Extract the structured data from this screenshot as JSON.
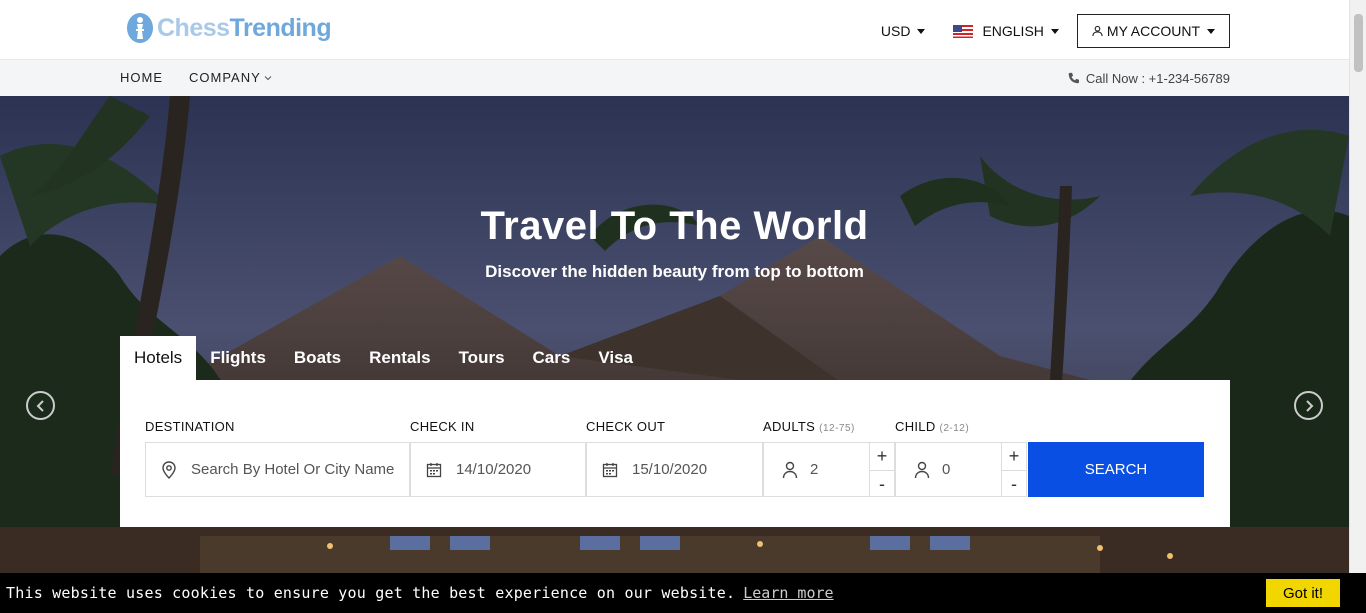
{
  "header": {
    "logo_text_a": "Chess",
    "logo_text_b": "Trending",
    "currency": "USD",
    "language": "ENGLISH",
    "account_label": "MY ACCOUNT"
  },
  "nav": {
    "items": [
      {
        "label": "HOME"
      },
      {
        "label": "COMPANY"
      }
    ],
    "call_text": "Call Now : +1-234-56789"
  },
  "hero": {
    "title": "Travel To The World",
    "subtitle": "Discover the hidden beauty from top to bottom"
  },
  "search": {
    "tabs": [
      {
        "label": "Hotels",
        "active": true
      },
      {
        "label": "Flights"
      },
      {
        "label": "Boats"
      },
      {
        "label": "Rentals"
      },
      {
        "label": "Tours"
      },
      {
        "label": "Cars"
      },
      {
        "label": "Visa"
      }
    ],
    "labels": {
      "destination": "DESTINATION",
      "check_in": "CHECK IN",
      "check_out": "CHECK OUT",
      "adults": "ADULTS",
      "adults_range": "(12-75)",
      "child": "CHILD",
      "child_range": "(2-12)"
    },
    "destination_placeholder": "Search By Hotel Or City Name",
    "check_in_value": "14/10/2020",
    "check_out_value": "15/10/2020",
    "adults_value": "2",
    "child_value": "0",
    "plus": "+",
    "minus": "-",
    "button_label": "SEARCH"
  },
  "cookie": {
    "text": "This website uses cookies to ensure you get the best experience on our website.",
    "link": "Learn more",
    "button": "Got it!"
  },
  "colors": {
    "accent": "#0a4fe3",
    "cookie_button": "#f1d600",
    "logo": "#6fa8dc"
  },
  "icons": [
    "user-icon",
    "us-flag-icon",
    "phone-icon",
    "map-pin-icon",
    "calendar-icon",
    "chevron-left-icon",
    "chevron-right-icon"
  ]
}
